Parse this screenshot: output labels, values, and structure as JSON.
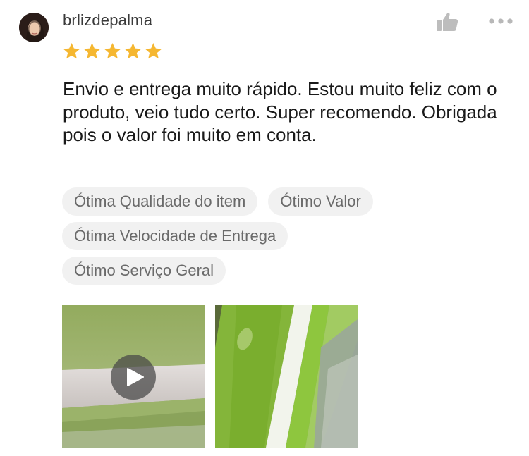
{
  "review": {
    "username": "brlizdepalma",
    "rating": 5,
    "max_rating": 5,
    "text": "Envio e entrega muito rápido. Estou muito feliz com o produto, veio tudo certo. Super recomendo. Obrigada pois o valor foi muito em conta.",
    "tags": [
      "Ótima Qualidade do item",
      "Ótimo Valor",
      "Ótima Velocidade de Entrega",
      "Ótimo Serviço Geral"
    ]
  },
  "icons": {
    "like": "thumbs-up-icon",
    "more": "more-dots-icon",
    "star": "star-icon",
    "play": "play-icon"
  },
  "colors": {
    "star": "#f5b731",
    "icon_gray": "#bdbdbd",
    "tag_bg": "#f1f1f1",
    "tag_text": "#6a6a6a",
    "text": "#1a1a1a"
  }
}
